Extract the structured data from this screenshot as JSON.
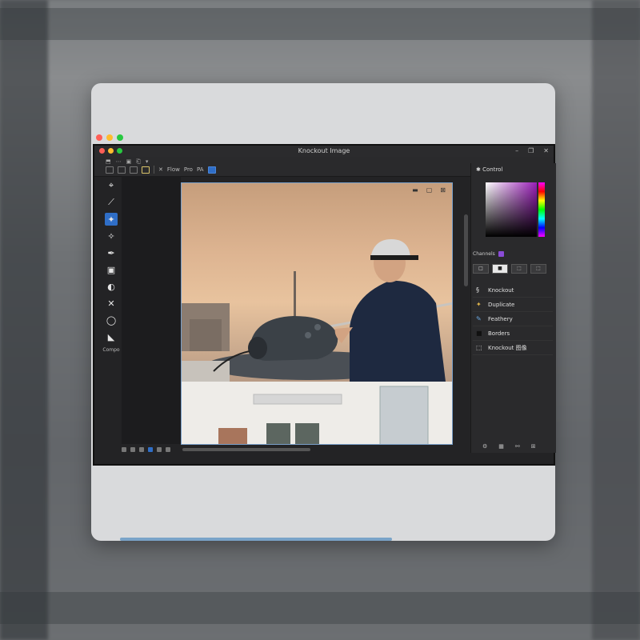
{
  "window": {
    "title": "Knockout Image"
  },
  "toolbar": {
    "menu_items": [
      "⬒",
      "⋯",
      "▣",
      "⎗",
      "▾"
    ],
    "labels": [
      "Flow",
      "Pro",
      "PA"
    ]
  },
  "tools": {
    "items": [
      "lasso-icon",
      "brush-icon",
      "magic-wand-icon",
      "eraser-icon",
      "pen-icon",
      "crop-icon",
      "transform-icon",
      "cut-icon",
      "shape-icon",
      "select-icon"
    ],
    "label": "Compo"
  },
  "panel": {
    "title": "Control",
    "layers_tab": "Channels",
    "layers": [
      {
        "icon": "§",
        "name": "Knockout"
      },
      {
        "icon": "✦",
        "name": "Duplicate"
      },
      {
        "icon": "✎",
        "name": "Feathery"
      },
      {
        "icon": "■",
        "name": "Borders"
      },
      {
        "icon": "⬚",
        "name": "Knockout 图像"
      }
    ],
    "layer_buttons": [
      "□",
      "■",
      "⬚",
      "⬚"
    ]
  },
  "colors": {
    "accent": "#2f6ec7",
    "panel_bg": "#2a2a2c",
    "mac_red": "#ff5f57",
    "mac_yellow": "#febc2e",
    "mac_green": "#28c840"
  }
}
